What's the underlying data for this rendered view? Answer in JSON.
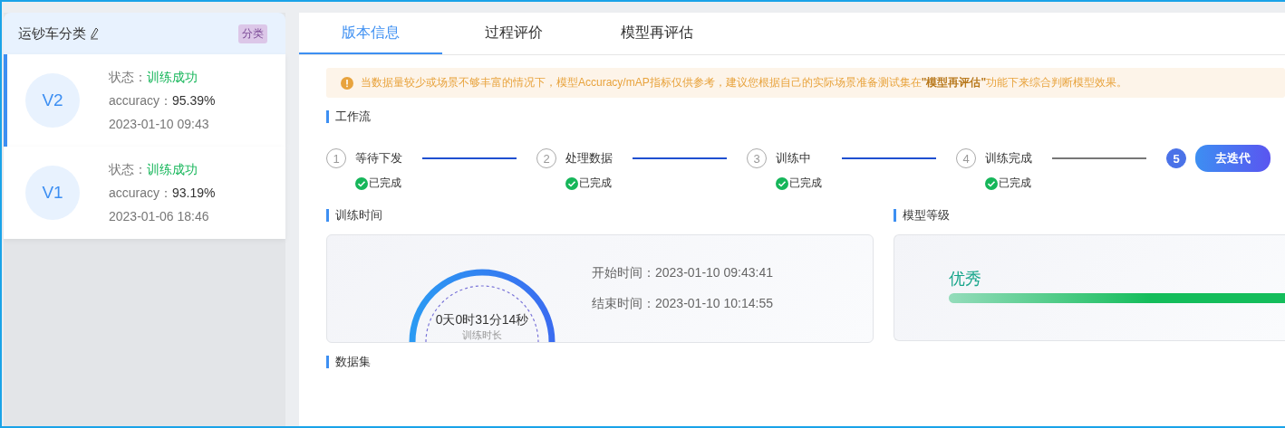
{
  "project": {
    "title": "运钞车分类",
    "tag": "分类"
  },
  "versions": [
    {
      "badge": "V2",
      "status_label": "状态：",
      "status": "训练成功",
      "accuracy_label": "accuracy：",
      "accuracy": "95.39%",
      "date": "2023-01-10 09:43",
      "selected": true
    },
    {
      "badge": "V1",
      "status_label": "状态：",
      "status": "训练成功",
      "accuracy_label": "accuracy：",
      "accuracy": "93.19%",
      "date": "2023-01-06 18:46",
      "selected": false
    }
  ],
  "tabs": [
    {
      "label": "版本信息",
      "selected": true
    },
    {
      "label": "过程评价",
      "selected": false
    },
    {
      "label": "模型再评估",
      "selected": false
    }
  ],
  "alert": "当数据量较少或场景不够丰富的情况下，模型Accuracy/mAP指标仅供参考，建议您根据自己的实际场景准备测试集在**\"模型再评估\"**功能下来综合判断模型效果。",
  "workflow": {
    "title": "工作流",
    "steps": [
      {
        "number": "1",
        "label": "等待下发",
        "done": true,
        "status": "已完成"
      },
      {
        "number": "2",
        "label": "处理数据",
        "done": true,
        "status": "已完成"
      },
      {
        "number": "3",
        "label": "训练中",
        "done": true,
        "status": "已完成"
      },
      {
        "number": "4",
        "label": "训练完成",
        "done": true,
        "status": "已完成"
      },
      {
        "number": "5",
        "done": false,
        "button": "去迭代"
      }
    ]
  },
  "training_time": {
    "title": "训练时间",
    "duration": "0天0时31分14秒",
    "duration_label": "训练时长",
    "start_label": "开始时间：",
    "start": "2023-01-10 09:43:41",
    "end_label": "结束时间：",
    "end": "2023-01-10 10:14:55"
  },
  "model_grade": {
    "title": "模型等级",
    "grade": "优秀"
  },
  "dataset": {
    "title": "数据集"
  }
}
